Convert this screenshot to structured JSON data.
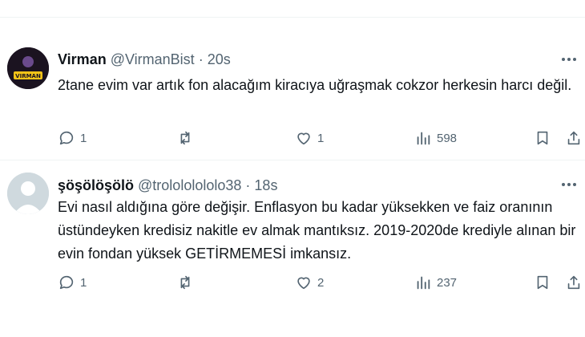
{
  "tweets": [
    {
      "display_name": "Virman",
      "handle": "@VirmanBist",
      "separator": "·",
      "time": "20s",
      "avatar_text": "VIRMAN",
      "text": "2tane evim var artık fon alacağım kiracıya uğraşmak cokzor herkesin harcı değil.",
      "replies": "1",
      "reposts": "",
      "likes": "1",
      "views": "598"
    },
    {
      "display_name": "şöşölöşölö",
      "handle": "@trolololololo38",
      "separator": "·",
      "time": "18s",
      "text": "Evi nasıl aldığına göre değişir. Enflasyon bu kadar yüksekken ve faiz oranının üstündeyken kredisiz nakitle ev almak mantıksız. 2019-2020de krediyle alınan bir evin fondan yüksek GETİRMEMESİ imkansız.",
      "replies": "1",
      "reposts": "",
      "likes": "2",
      "views": "237"
    }
  ],
  "colors": {
    "text_primary": "#0f1419",
    "text_secondary": "#536471",
    "divider": "#eff3f4",
    "avatar_bg_1": "#1b1320",
    "avatar_accent_1": "#f2c318",
    "avatar_default": "#cfd9de"
  },
  "icons": [
    "reply-icon",
    "repost-icon",
    "like-icon",
    "views-icon",
    "bookmark-icon",
    "share-icon",
    "more-icon"
  ]
}
